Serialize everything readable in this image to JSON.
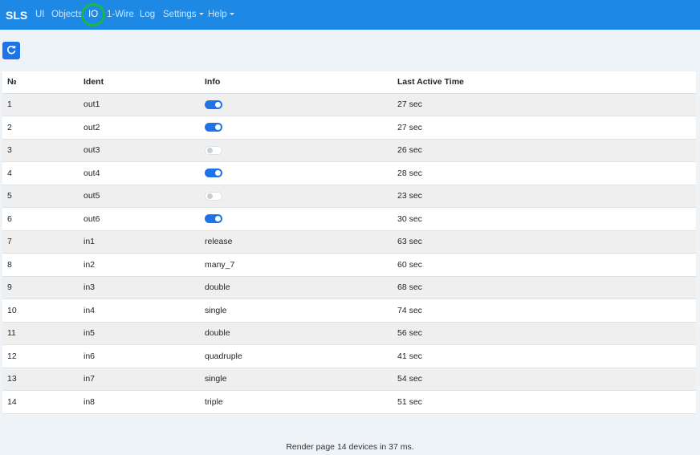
{
  "navbar": {
    "brand": "SLS",
    "items": [
      {
        "label": "UI"
      },
      {
        "label": "Objects"
      },
      {
        "label": "IO"
      },
      {
        "label": "1-Wire"
      },
      {
        "label": "Log"
      },
      {
        "label": "Settings"
      },
      {
        "label": "Help"
      }
    ],
    "bg_color": "#1e88e5",
    "active_highlight_color": "#18b84a"
  },
  "toolbar": {
    "refresh_icon": "refresh-icon"
  },
  "table": {
    "headers": [
      "№",
      "Ident",
      "Info",
      "Last Active Time"
    ],
    "rows": [
      {
        "num": "1",
        "ident": "out1",
        "info_type": "switch",
        "switch_on": true,
        "time": "27 sec"
      },
      {
        "num": "2",
        "ident": "out2",
        "info_type": "switch",
        "switch_on": true,
        "time": "27 sec"
      },
      {
        "num": "3",
        "ident": "out3",
        "info_type": "switch",
        "switch_on": false,
        "time": "26 sec"
      },
      {
        "num": "4",
        "ident": "out4",
        "info_type": "switch",
        "switch_on": true,
        "time": "28 sec"
      },
      {
        "num": "5",
        "ident": "out5",
        "info_type": "switch",
        "switch_on": false,
        "time": "23 sec"
      },
      {
        "num": "6",
        "ident": "out6",
        "info_type": "switch",
        "switch_on": true,
        "time": "30 sec"
      },
      {
        "num": "7",
        "ident": "in1",
        "info_type": "text",
        "info": "release",
        "time": "63 sec"
      },
      {
        "num": "8",
        "ident": "in2",
        "info_type": "text",
        "info": "many_7",
        "time": "60 sec"
      },
      {
        "num": "9",
        "ident": "in3",
        "info_type": "text",
        "info": "double",
        "time": "68 sec"
      },
      {
        "num": "10",
        "ident": "in4",
        "info_type": "text",
        "info": "single",
        "time": "74 sec"
      },
      {
        "num": "11",
        "ident": "in5",
        "info_type": "text",
        "info": "double",
        "time": "56 sec"
      },
      {
        "num": "12",
        "ident": "in6",
        "info_type": "text",
        "info": "quadruple",
        "time": "41 sec"
      },
      {
        "num": "13",
        "ident": "in7",
        "info_type": "text",
        "info": "single",
        "time": "54 sec"
      },
      {
        "num": "14",
        "ident": "in8",
        "info_type": "text",
        "info": "triple",
        "time": "51 sec"
      }
    ]
  },
  "footer": {
    "text": "Render page 14 devices in 37 ms."
  }
}
